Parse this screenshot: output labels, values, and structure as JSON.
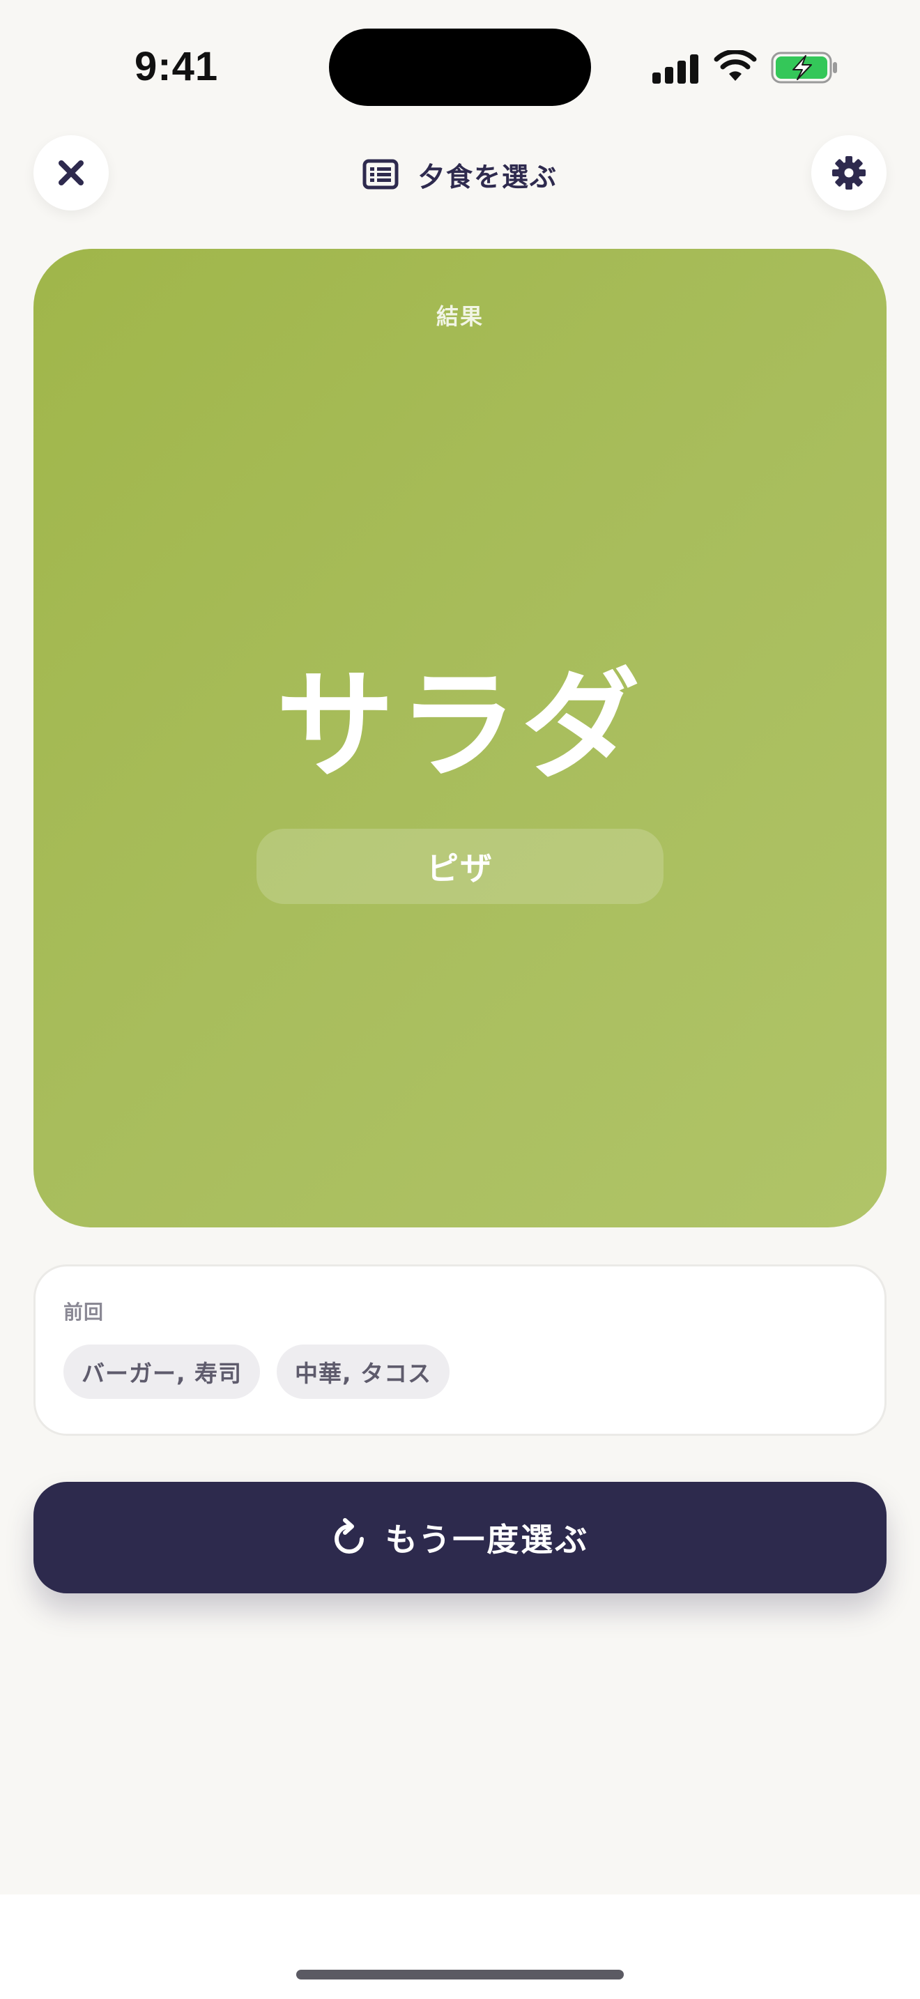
{
  "status_bar": {
    "time": "9:41",
    "icons": [
      "cellular-signal-icon",
      "wifi-icon",
      "battery-charging-icon"
    ],
    "battery_color": "#34c759"
  },
  "header": {
    "close_icon": "close-icon",
    "title_icon": "list-icon",
    "title": "夕食を選ぶ",
    "settings_icon": "gear-icon"
  },
  "result": {
    "label": "結果",
    "choice": "サラダ",
    "sub_choice": "ピザ",
    "accent_color": "#a4ba52"
  },
  "history": {
    "label": "前回",
    "items": [
      "バーガー, 寿司",
      "中華, タコス"
    ]
  },
  "action": {
    "icon": "refresh-icon",
    "label": "もう一度選ぶ",
    "color": "#2d2a4d"
  }
}
